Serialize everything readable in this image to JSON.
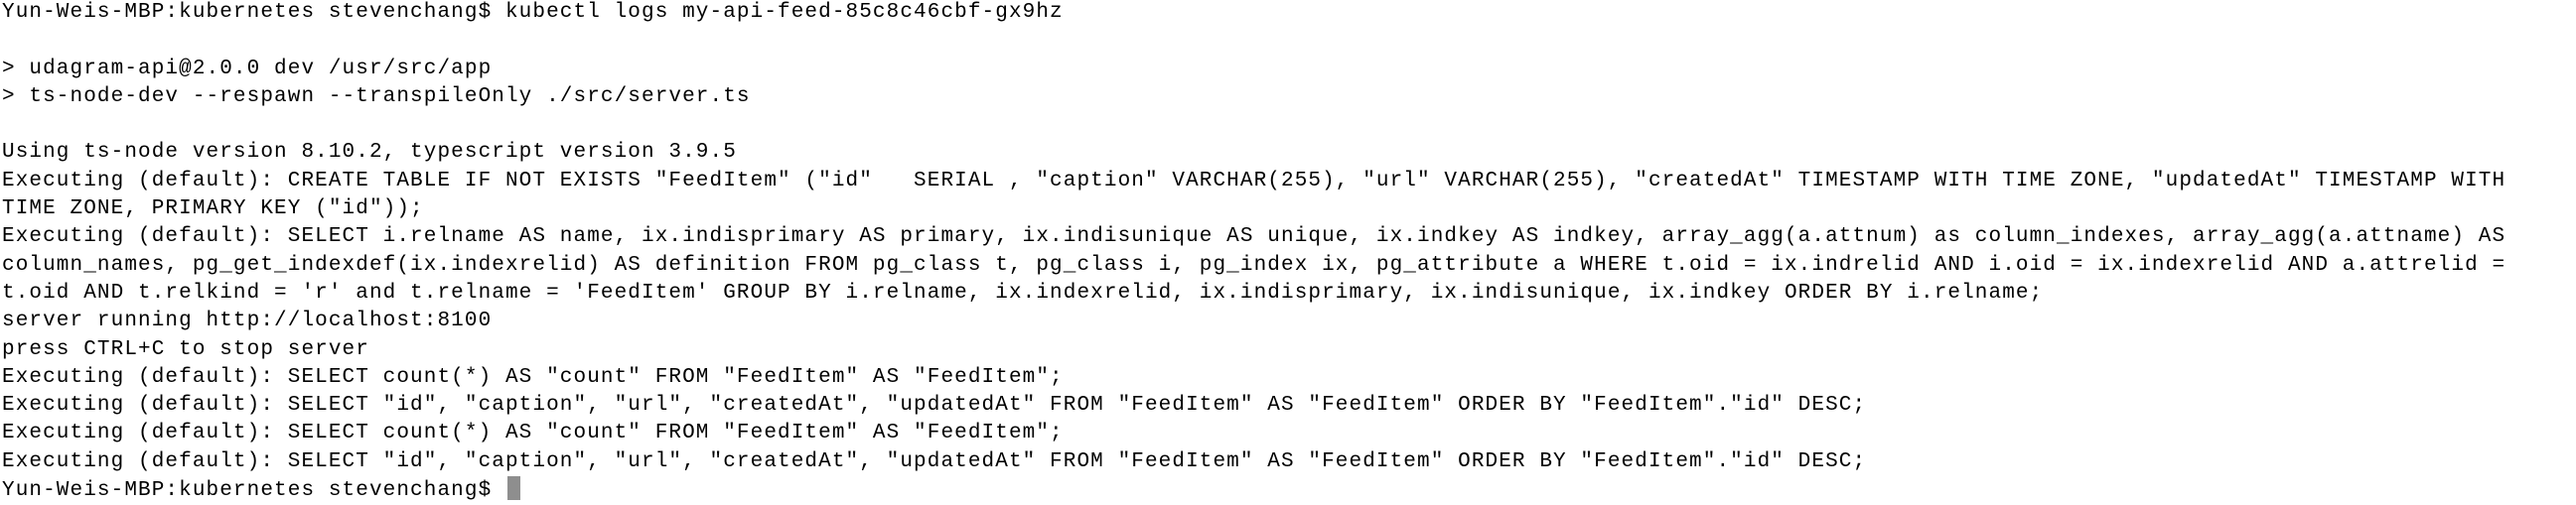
{
  "terminal": {
    "cursor_color": "#8e8e8e",
    "lines": [
      "Yun-Weis-MBP:kubernetes stevenchang$ kubectl logs my-api-feed-85c8c46cbf-gx9hz",
      "",
      "> udagram-api@2.0.0 dev /usr/src/app",
      "> ts-node-dev --respawn --transpileOnly ./src/server.ts",
      "",
      "Using ts-node version 8.10.2, typescript version 3.9.5",
      "Executing (default): CREATE TABLE IF NOT EXISTS \"FeedItem\" (\"id\"   SERIAL , \"caption\" VARCHAR(255), \"url\" VARCHAR(255), \"createdAt\" TIMESTAMP WITH TIME ZONE, \"updatedAt\" TIMESTAMP WITH",
      "TIME ZONE, PRIMARY KEY (\"id\"));",
      "Executing (default): SELECT i.relname AS name, ix.indisprimary AS primary, ix.indisunique AS unique, ix.indkey AS indkey, array_agg(a.attnum) as column_indexes, array_agg(a.attname) AS",
      "column_names, pg_get_indexdef(ix.indexrelid) AS definition FROM pg_class t, pg_class i, pg_index ix, pg_attribute a WHERE t.oid = ix.indrelid AND i.oid = ix.indexrelid AND a.attrelid =",
      "t.oid AND t.relkind = 'r' and t.relname = 'FeedItem' GROUP BY i.relname, ix.indexrelid, ix.indisprimary, ix.indisunique, ix.indkey ORDER BY i.relname;",
      "server running http://localhost:8100",
      "press CTRL+C to stop server",
      "Executing (default): SELECT count(*) AS \"count\" FROM \"FeedItem\" AS \"FeedItem\";",
      "Executing (default): SELECT \"id\", \"caption\", \"url\", \"createdAt\", \"updatedAt\" FROM \"FeedItem\" AS \"FeedItem\" ORDER BY \"FeedItem\".\"id\" DESC;",
      "Executing (default): SELECT count(*) AS \"count\" FROM \"FeedItem\" AS \"FeedItem\";",
      "Executing (default): SELECT \"id\", \"caption\", \"url\", \"createdAt\", \"updatedAt\" FROM \"FeedItem\" AS \"FeedItem\" ORDER BY \"FeedItem\".\"id\" DESC;"
    ],
    "prompt": "Yun-Weis-MBP:kubernetes stevenchang$ "
  }
}
